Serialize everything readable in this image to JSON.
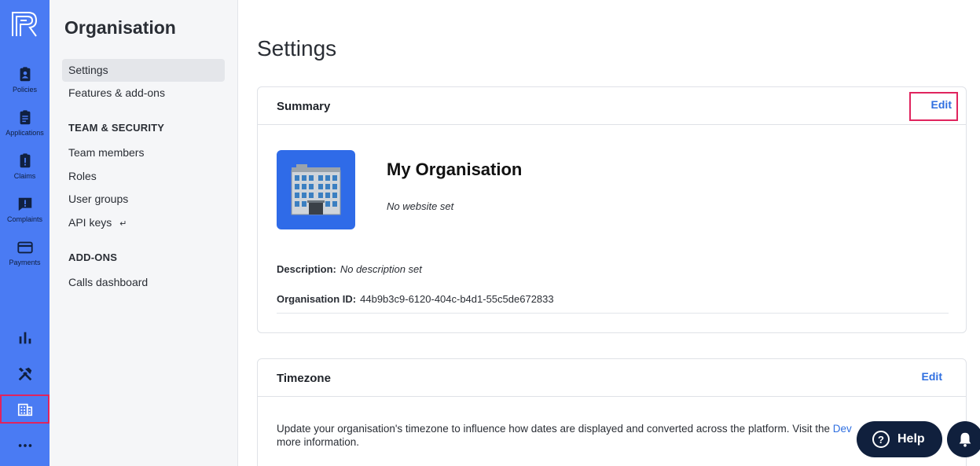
{
  "rail": {
    "items": [
      {
        "label": "Policies",
        "icon": "policies-icon"
      },
      {
        "label": "Applications",
        "icon": "applications-icon"
      },
      {
        "label": "Claims",
        "icon": "claims-icon"
      },
      {
        "label": "Complaints",
        "icon": "complaints-icon"
      },
      {
        "label": "Payments",
        "icon": "payments-icon"
      }
    ],
    "bottom_icons": [
      "analytics-icon",
      "tools-icon",
      "organisation-icon",
      "more-icon"
    ]
  },
  "subnav": {
    "title": "Organisation",
    "items": [
      {
        "label": "Settings"
      },
      {
        "label": "Features & add-ons"
      }
    ],
    "section_team": "TEAM & SECURITY",
    "team_items": [
      {
        "label": "Team members"
      },
      {
        "label": "Roles"
      },
      {
        "label": "User groups"
      },
      {
        "label": "API keys"
      }
    ],
    "api_keys_suffix": "↵",
    "section_addons": "ADD-ONS",
    "addon_items": [
      {
        "label": "Calls dashboard"
      }
    ]
  },
  "main": {
    "title": "Settings",
    "summary": {
      "title": "Summary",
      "edit_label": "Edit",
      "org_name": "My Organisation",
      "website": "No website set",
      "description_label": "Description:",
      "description_value": "No description set",
      "org_id_label": "Organisation ID:",
      "org_id_value": "44b9b3c9-6120-404c-b4d1-55c5de672833"
    },
    "timezone": {
      "title": "Timezone",
      "edit_label": "Edit",
      "text_before": "Update your organisation's timezone to influence how dates are displayed and converted across the platform. Visit the ",
      "link": "Dev",
      "text_after": "more information."
    }
  },
  "floating": {
    "help_label": "Help",
    "help_glyph": "?"
  },
  "colors": {
    "rail": "#4a7bf3",
    "accent": "#2f6fe0",
    "highlight": "#e0245e",
    "dark": "#10203d"
  }
}
